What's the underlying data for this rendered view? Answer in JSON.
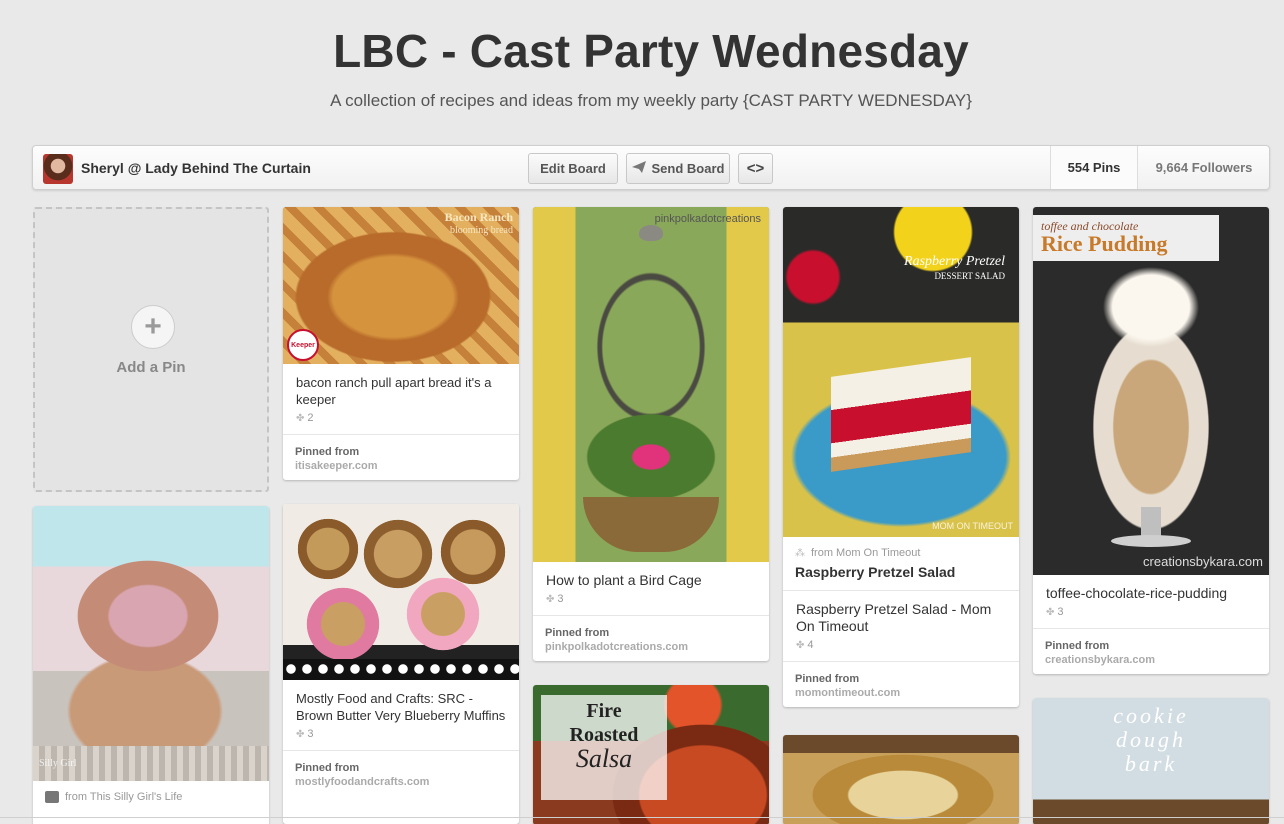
{
  "board": {
    "title": "LBC - Cast Party Wednesday",
    "description": "A collection of recipes and ideas from my weekly party {CAST PARTY WEDNESDAY}"
  },
  "toolbar": {
    "owner_name": "Sheryl @ Lady Behind The Curtain",
    "edit_label": "Edit Board",
    "send_label": "Send Board",
    "embed_label": "<>",
    "pins_count": "554 Pins",
    "followers_count": "9,664 Followers"
  },
  "add_pin": {
    "label": "Add a Pin"
  },
  "pins": [
    {
      "image_text": [
        "Bacon Ranch",
        "blooming bread"
      ],
      "badge": "Keeper",
      "description": "bacon ranch pull apart bread it's a keeper",
      "repins": "2",
      "pinned_label": "Pinned from",
      "source": "itisakeeper.com"
    },
    {
      "watermark": "pinkpolkadotcreations",
      "description": "How to plant a Bird Cage",
      "repins": "3",
      "pinned_label": "Pinned from",
      "source": "pinkpolkadotcreations.com"
    },
    {
      "image_text": [
        "Raspberry Pretzel",
        "DESSERT SALAD"
      ],
      "watermark": "MOM ON TIMEOUT",
      "from_text": "from Mom On Timeout",
      "rich_title": "Raspberry Pretzel Salad",
      "description": "Raspberry Pretzel Salad - Mom On Timeout",
      "repins": "4",
      "pinned_label": "Pinned from",
      "source": "momontimeout.com"
    },
    {
      "image_text": [
        "toffee and chocolate",
        "Rice Pudding"
      ],
      "watermark": "creationsbykara.com",
      "description": "toffee-chocolate-rice-pudding",
      "repins": "3",
      "pinned_label": "Pinned from",
      "source": "creationsbykara.com"
    },
    {
      "watermark": "Silly Girl",
      "from_text": "from This Silly Girl's Life"
    },
    {
      "description": "Mostly Food and Crafts: SRC - Brown Butter Very Blueberry Muffins",
      "repins": "3",
      "pinned_label": "Pinned from",
      "source": "mostlyfoodandcrafts.com"
    },
    {
      "image_text": [
        "Fire",
        "Roasted",
        "Salsa"
      ]
    },
    {
      "image_text": [
        "cookie",
        "dough",
        "bark"
      ]
    }
  ],
  "colors": {
    "background": "#e9e9e9",
    "accent_red": "#c8102e"
  }
}
